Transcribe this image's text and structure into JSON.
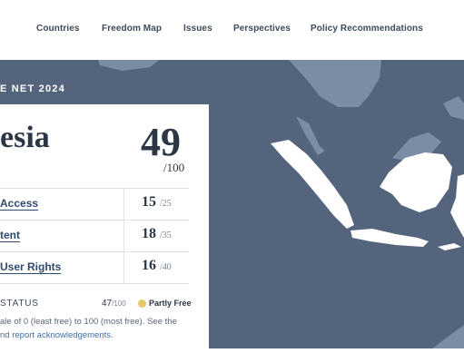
{
  "nav": {
    "items": [
      {
        "label": "Countries"
      },
      {
        "label": "Freedom Map"
      },
      {
        "label": "Issues"
      },
      {
        "label": "Perspectives"
      },
      {
        "label": "Policy Recommendations"
      }
    ]
  },
  "banner": {
    "label": "E NET 2024"
  },
  "country": {
    "name": "esia",
    "score": "49",
    "score_max": "/100"
  },
  "categories": [
    {
      "label": "Access",
      "score": "15",
      "max": "/25"
    },
    {
      "label": "tent",
      "score": "18",
      "max": "/35"
    },
    {
      "label": "User Rights",
      "score": "16",
      "max": "/40"
    }
  ],
  "status": {
    "label": "STATUS",
    "score": "47",
    "score_max": "/100",
    "text": "Partly Free",
    "color": "#e7c866"
  },
  "scale": {
    "line1": "ale of 0 (least free) to 100 (most free). See the",
    "line2_prefix": "nd ",
    "line2_link": "report acknowledgements",
    "line2_suffix": "."
  },
  "colors": {
    "map_water": "#53647c",
    "land_focus": "#ffffff",
    "land_other": "#7c8ca4"
  }
}
